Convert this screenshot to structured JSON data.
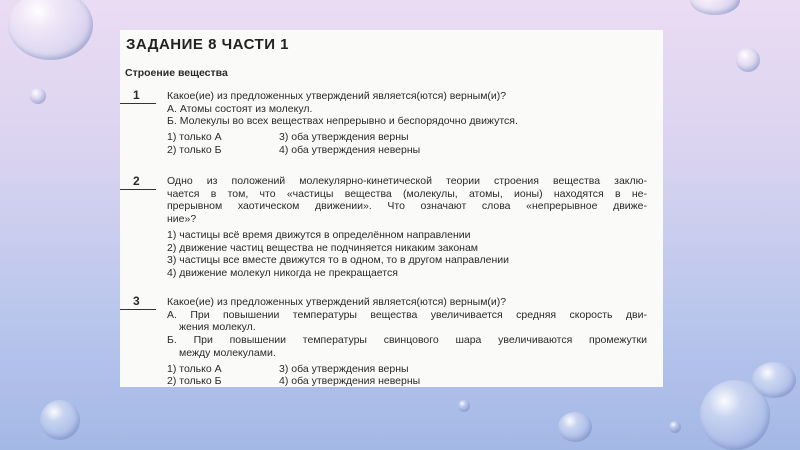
{
  "title": "ЗАДАНИЕ 8 ЧАСТИ 1",
  "subtitle": "Строение вещества",
  "questions": [
    {
      "number": "1",
      "lines": [
        "Какое(ие) из предложенных утверждений является(ются) верным(и)?",
        "А. Атомы состоят из молекул.",
        "Б. Молекулы во всех веществах непрерывно и беспорядочно движутся."
      ],
      "options": [
        "1) только А",
        "3) оба утверждения верны",
        "2) только Б",
        "4) оба утверждения неверны"
      ]
    },
    {
      "number": "2",
      "lines": [
        "Одно из положений молекулярно-кинетической теории строения вещества заклю-",
        "чается в том, что «частицы вещества (молекулы, атомы, ионы) находятся в не-",
        "прерывном хаотическом движении». Что означают слова «непрерывное движе-",
        "ние»?"
      ],
      "options": [
        "1) частицы всё время движутся в определённом направлении",
        "2) движение частиц вещества не подчиняется никаким законам",
        "3) частицы все вместе движутся то в одном, то в другом направлении",
        "4) движение молекул никогда не прекращается"
      ]
    },
    {
      "number": "3",
      "lines": [
        "Какое(ие) из предложенных утверждений является(ются) верным(и)?",
        "А. При повышении температуры вещества увеличивается средняя скорость дви-",
        "жения молекул.",
        "Б. При повышении температуры свинцового шара увеличиваются промежутки",
        "между молекулами."
      ],
      "options": [
        "1) только А",
        "3) оба утверждения верны",
        "2) только Б",
        "4) оба утверждения неверны"
      ]
    }
  ]
}
